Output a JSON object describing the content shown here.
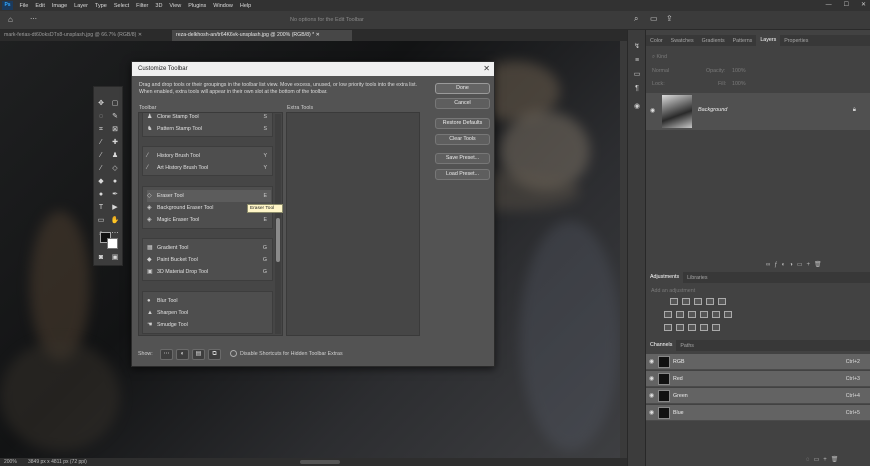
{
  "menubar": {
    "items": [
      "File",
      "Edit",
      "Image",
      "Layer",
      "Type",
      "Select",
      "Filter",
      "3D",
      "View",
      "Plugins",
      "Window",
      "Help"
    ]
  },
  "optionsbar": {
    "message": "No options for the Edit Toolbar"
  },
  "doc_tabs": [
    "mark-ferias-dt60oksDTx8-unsplash.jpg @ 66.7% (RGB/8)",
    "reza-delkhosh-an/tr64K6vk-unsplash.jpg @ 200% (RGB/8) *"
  ],
  "status": {
    "zoom": "200%",
    "size": "3849 px x 4811 px (72 ppi)"
  },
  "panels": {
    "top_tabs": [
      "Color",
      "Swatches",
      "Gradients",
      "Patterns",
      "Layers",
      "Properties"
    ],
    "kind": "Kind",
    "blend": "Normal",
    "opacity_label": "Opacity:",
    "opacity_val": "100%",
    "lock_label": "Lock:",
    "fill_label": "Fill:",
    "fill_val": "100%",
    "layer_name": "Background",
    "adj_tabs": [
      "Adjustments",
      "Libraries"
    ],
    "add_adjustment": "Add an adjustment",
    "ch_tabs": [
      "Channels",
      "Paths"
    ],
    "channels": [
      {
        "name": "RGB",
        "key": "Ctrl+2"
      },
      {
        "name": "Red",
        "key": "Ctrl+3"
      },
      {
        "name": "Green",
        "key": "Ctrl+4"
      },
      {
        "name": "Blue",
        "key": "Ctrl+5"
      }
    ]
  },
  "dialog": {
    "title": "Customize Toolbar",
    "description": "Drag and drop tools or their groupings in the toolbar list view. Move excess, unused, or low priority tools into the extra list. When enabled, extra tools will appear in their own slot at the bottom of the toolbar.",
    "toolbar_label": "Toolbar",
    "extra_label": "Extra Tools",
    "groups": [
      [
        {
          "name": "Clone Stamp Tool",
          "key": "S",
          "icon": "stamp-icon"
        },
        {
          "name": "Pattern Stamp Tool",
          "key": "S",
          "icon": "pattern-stamp-icon"
        }
      ],
      [
        {
          "name": "History Brush Tool",
          "key": "Y",
          "icon": "history-brush-icon"
        },
        {
          "name": "Art History Brush Tool",
          "key": "Y",
          "icon": "art-history-brush-icon"
        }
      ],
      [
        {
          "name": "Eraser Tool",
          "key": "E",
          "icon": "eraser-icon"
        },
        {
          "name": "Background Eraser Tool",
          "key": "E",
          "icon": "background-eraser-icon"
        },
        {
          "name": "Magic Eraser Tool",
          "key": "E",
          "icon": "magic-eraser-icon"
        }
      ],
      [
        {
          "name": "Gradient Tool",
          "key": "G",
          "icon": "gradient-icon"
        },
        {
          "name": "Paint Bucket Tool",
          "key": "G",
          "icon": "paint-bucket-icon"
        },
        {
          "name": "3D Material Drop Tool",
          "key": "G",
          "icon": "material-drop-icon"
        }
      ],
      [
        {
          "name": "Blur Tool",
          "key": "",
          "icon": "blur-icon"
        },
        {
          "name": "Sharpen Tool",
          "key": "",
          "icon": "sharpen-icon"
        },
        {
          "name": "Smudge Tool",
          "key": "",
          "icon": "smudge-icon"
        }
      ]
    ],
    "buttons": [
      "Done",
      "Cancel",
      "Restore Defaults",
      "Clear Tools",
      "Save Preset...",
      "Load Preset..."
    ],
    "show_label": "Show:",
    "checkbox_label": "Disable Shortcuts for Hidden Toolbar Extras",
    "tooltip": "Eraser Tool"
  }
}
